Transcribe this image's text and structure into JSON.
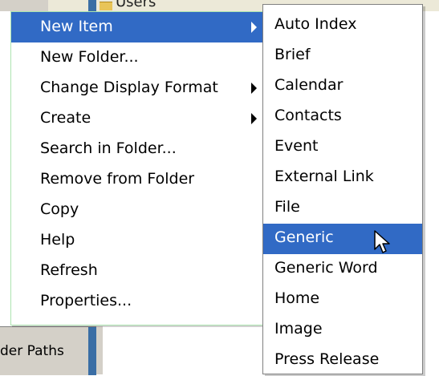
{
  "background": {
    "top_text": "Users",
    "bottom_label": "der Paths"
  },
  "menu": {
    "items": [
      {
        "label": "New Item",
        "has_submenu": true,
        "highlighted": true
      },
      {
        "label": "New Folder...",
        "has_submenu": false
      },
      {
        "label": "Change Display Format",
        "has_submenu": true
      },
      {
        "label": "Create",
        "has_submenu": true
      },
      {
        "label": "Search in Folder...",
        "has_submenu": false
      },
      {
        "label": "Remove from Folder",
        "has_submenu": false
      },
      {
        "label": "Copy",
        "has_submenu": false
      },
      {
        "label": "Help",
        "has_submenu": false
      },
      {
        "label": "Refresh",
        "has_submenu": false
      },
      {
        "label": "Properties...",
        "has_submenu": false
      }
    ]
  },
  "submenu": {
    "items": [
      {
        "label": "Auto Index"
      },
      {
        "label": "Brief"
      },
      {
        "label": "Calendar"
      },
      {
        "label": "Contacts"
      },
      {
        "label": "Event"
      },
      {
        "label": "External Link"
      },
      {
        "label": "File"
      },
      {
        "label": "Generic",
        "highlighted": true
      },
      {
        "label": "Generic Word"
      },
      {
        "label": "Home"
      },
      {
        "label": "Image"
      },
      {
        "label": "Press Release"
      }
    ]
  },
  "colors": {
    "highlight": "#316ac5",
    "highlight_text": "#ffffff",
    "menu_background": "#ffffff"
  },
  "cursor": "arrow-cursor-icon"
}
